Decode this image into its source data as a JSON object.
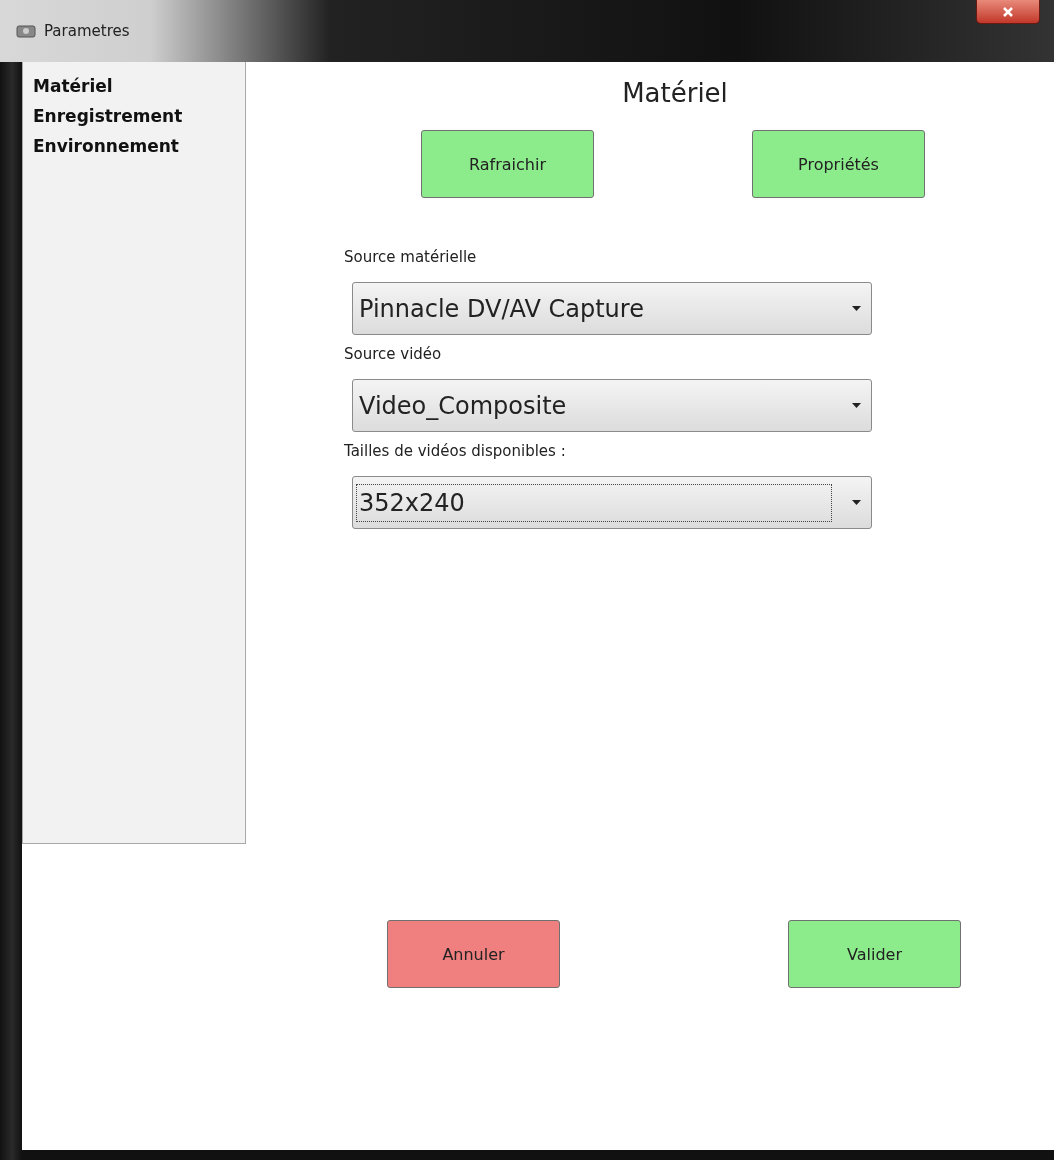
{
  "window": {
    "title": "Parametres"
  },
  "sidebar": {
    "items": [
      {
        "label": "Matériel"
      },
      {
        "label": "Enregistrement"
      },
      {
        "label": "Environnement"
      }
    ]
  },
  "page_title": "Matériel",
  "top_buttons": [
    {
      "label": "Rafraichir",
      "kind": "confirm"
    },
    {
      "label": "Propriétés",
      "kind": "confirm"
    }
  ],
  "fields": [
    {
      "label": "Source matérielle",
      "value": "Pinnacle DV/AV Capture",
      "focused": false
    },
    {
      "label": "Source vidéo",
      "value": "Video_Composite",
      "focused": false
    },
    {
      "label": "Tailles de vidéos disponibles :",
      "value": "352x240",
      "focused": true
    }
  ],
  "bottom_buttons": [
    {
      "label": "Annuler",
      "kind": "cancel"
    },
    {
      "label": "Valider",
      "kind": "confirm"
    }
  ]
}
